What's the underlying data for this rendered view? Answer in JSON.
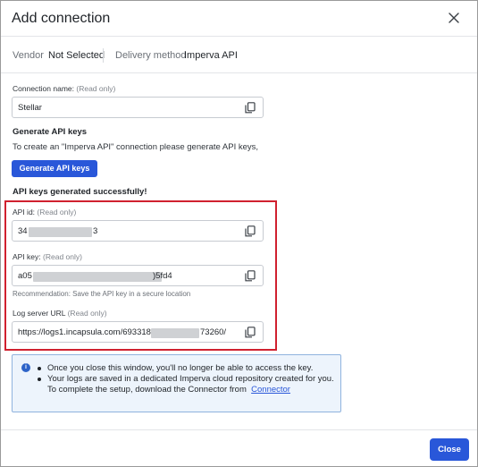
{
  "dialog": {
    "title": "Add connection",
    "close_icon": "close-icon"
  },
  "meta": {
    "vendor_label": "Vendor",
    "vendor_value": "Not Selected",
    "delivery_label": "Delivery method",
    "delivery_value": "Imperva API"
  },
  "connection_name": {
    "label": "Connection name:",
    "readonly": "(Read only)",
    "value": "Stellar",
    "icon": "copy-icon"
  },
  "generate": {
    "heading": "Generate API keys",
    "description": "To create an \"Imperva API\" connection please generate API keys,",
    "button_label": "Generate API keys",
    "success": "API keys generated successfully!"
  },
  "api_id": {
    "label": "API id:",
    "readonly": "(Read only)",
    "prefix": "34",
    "suffix": "3",
    "icon": "copy-icon"
  },
  "api_key": {
    "label": "API key:",
    "readonly": "(Read only)",
    "prefix": "a05",
    "suffix": ")5fd4",
    "hint": "Recommendation: Save the API key in a secure location",
    "icon": "copy-icon"
  },
  "log_server": {
    "label": "Log server URL",
    "readonly": "(Read only)",
    "prefix": "https://logs1.incapsula.com/6933185",
    "suffix": "73260/",
    "icon": "copy-icon"
  },
  "info": {
    "icon": "info-icon",
    "bullets": [
      "Once you close this window, you'll no longer be able to access the key.",
      "Your logs are saved in a dedicated Imperva cloud repository created for you."
    ],
    "continuation": "To complete the setup, download the Connector from",
    "link": "Connector"
  },
  "footer": {
    "close_label": "Close"
  },
  "colors": {
    "primary": "#2957d9",
    "highlight_border": "#d0212f",
    "info_bg": "#edf4fc",
    "info_border": "#8fb3de"
  }
}
